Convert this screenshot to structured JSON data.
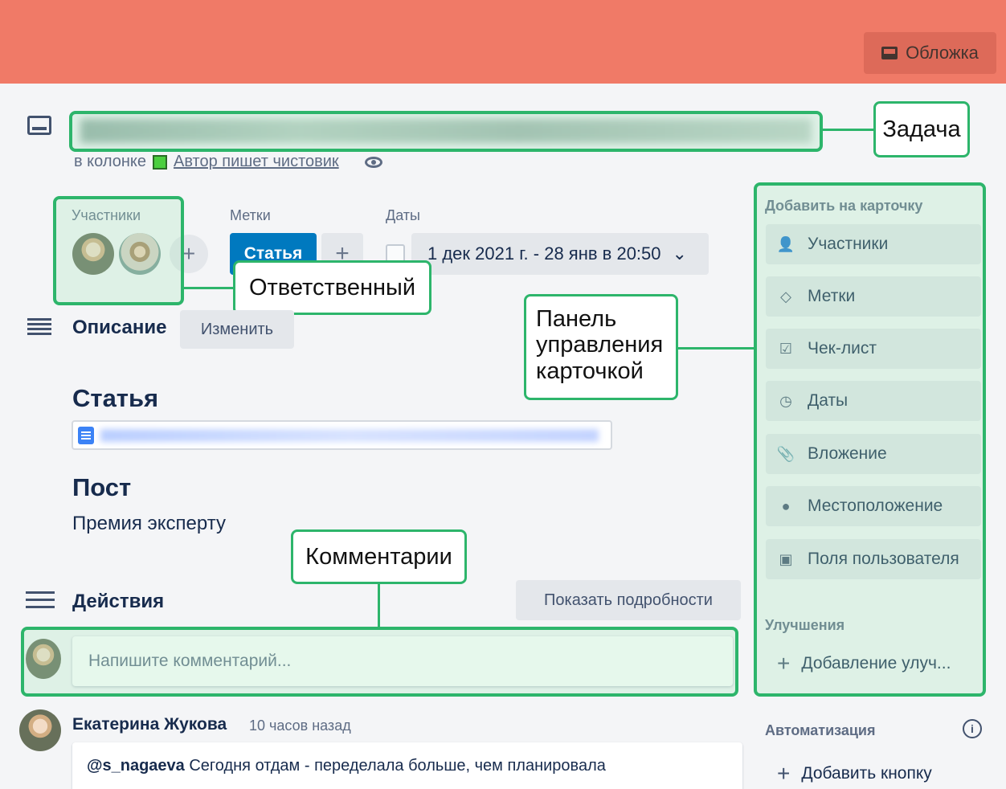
{
  "cover": {
    "button_label": "Обложка",
    "color": "#f07a67"
  },
  "card": {
    "column_prefix": "в колонке",
    "column_name": "Автор пишет чистовик"
  },
  "fields": {
    "members_label": "Участники",
    "labels_label": "Метки",
    "dates_label": "Даты",
    "label_chip": "Статья",
    "date_value": "1 дек 2021 г. - 28 янв в 20:50"
  },
  "description": {
    "title": "Описание",
    "edit_button": "Изменить",
    "article_heading": "Статья",
    "post_heading": "Пост",
    "post_text": "Премия эксперту"
  },
  "activity": {
    "title": "Действия",
    "details_button": "Показать подробности",
    "comment_placeholder": "Напишите комментарий...",
    "comment": {
      "author": "Екатерина Жукова",
      "time": "10 часов назад",
      "mention": "@s_nagaeva",
      "text": "Сегодня отдам - переделала больше, чем планировала"
    }
  },
  "sidebar": {
    "add_to_card_label": "Добавить на карточку",
    "items": [
      {
        "label": "Участники",
        "icon": "person-icon"
      },
      {
        "label": "Метки",
        "icon": "tag-icon"
      },
      {
        "label": "Чек-лист",
        "icon": "checklist-icon"
      },
      {
        "label": "Даты",
        "icon": "clock-icon"
      },
      {
        "label": "Вложение",
        "icon": "paperclip-icon"
      },
      {
        "label": "Местоположение",
        "icon": "location-pin-icon"
      },
      {
        "label": "Поля пользователя",
        "icon": "custom-fields-icon"
      }
    ],
    "powerups_label": "Улучшения",
    "powerups_button": "Добавление улуч...",
    "automation_label": "Автоматизация",
    "automation_button": "Добавить кнопку"
  },
  "callouts": {
    "task": "Задача",
    "assignee": "Ответственный",
    "panel": "Панель управления карточкой",
    "comments": "Комментарии"
  },
  "accent_color": "#2db56b"
}
